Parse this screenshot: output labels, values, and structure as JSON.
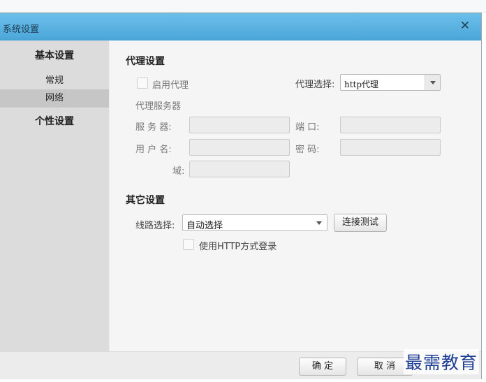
{
  "window": {
    "title": "系统设置"
  },
  "sidebar": {
    "groups": [
      {
        "label": "基本设置",
        "items": [
          {
            "label": "常规"
          },
          {
            "label": "网络"
          }
        ]
      },
      {
        "label": "个性设置"
      }
    ],
    "selected": "网络"
  },
  "proxy": {
    "section_title": "代理设置",
    "enable_label": "启用代理",
    "enabled": false,
    "select_label": "代理选择:",
    "select_value": "http代理",
    "server_group_label": "代理服务器",
    "server_label": "服 务 器:",
    "port_label": "端    口:",
    "user_label": "用 户 名:",
    "password_label": "密    码:",
    "domain_label": "域:",
    "server_value": "",
    "port_value": "",
    "user_value": "",
    "password_value": "",
    "domain_value": ""
  },
  "other": {
    "section_title": "其它设置",
    "route_label": "线路选择:",
    "route_value": "自动选择",
    "test_button": "连接测试",
    "http_login_label": "使用HTTP方式登录",
    "http_login_checked": false
  },
  "footer": {
    "ok_label": "确 定",
    "cancel_label": "取 消"
  },
  "watermark": {
    "text": "最需教育"
  }
}
